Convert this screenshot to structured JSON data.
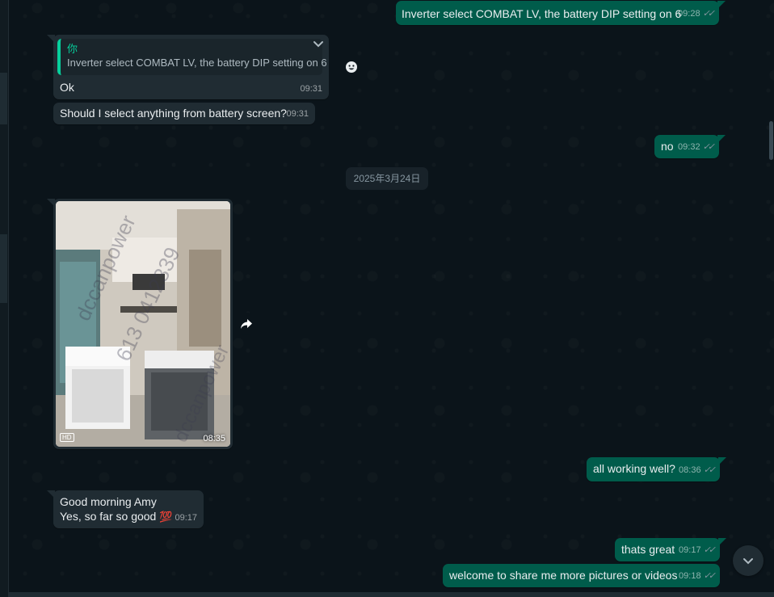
{
  "messages": {
    "m1": {
      "text": "Inverter select COMBAT LV, the battery DIP setting on 6",
      "time": "09:28"
    },
    "m2": {
      "quote_author": "你",
      "quote_text": "Inverter select COMBAT LV, the battery DIP setting on 6",
      "text": "Ok",
      "time": "09:31"
    },
    "m3": {
      "text": "Should I select anything from battery screen?",
      "time": "09:31"
    },
    "m4": {
      "text": "no",
      "time": "09:32"
    },
    "date_chip": "2025年3月24日",
    "photo": {
      "badge": "HD",
      "time": "08:35",
      "watermark_line1": "dccanpower",
      "watermark_line2": "613 0412339",
      "watermark_line3": "dccanpower"
    },
    "m5": {
      "text": "all working well?",
      "time": "08:36"
    },
    "m6": {
      "line1": "Good morning Amy",
      "line2": "Yes, so far so good",
      "emoji": "💯",
      "time": "09:17"
    },
    "m7": {
      "text": "thats great",
      "time": "09:17"
    },
    "m8": {
      "text": "welcome to share me more pictures or videos",
      "time": "09:18"
    }
  },
  "read_ticks": "✓✓",
  "icons": {
    "chevron": "chevron-down-icon",
    "emoji": "emoji-icon",
    "forward": "forward-icon",
    "scroll_down": "chevron-down-icon"
  },
  "colors": {
    "background": "#0b141a",
    "outgoing": "#005c4b",
    "incoming": "#202c33",
    "accent": "#06cf9c"
  }
}
